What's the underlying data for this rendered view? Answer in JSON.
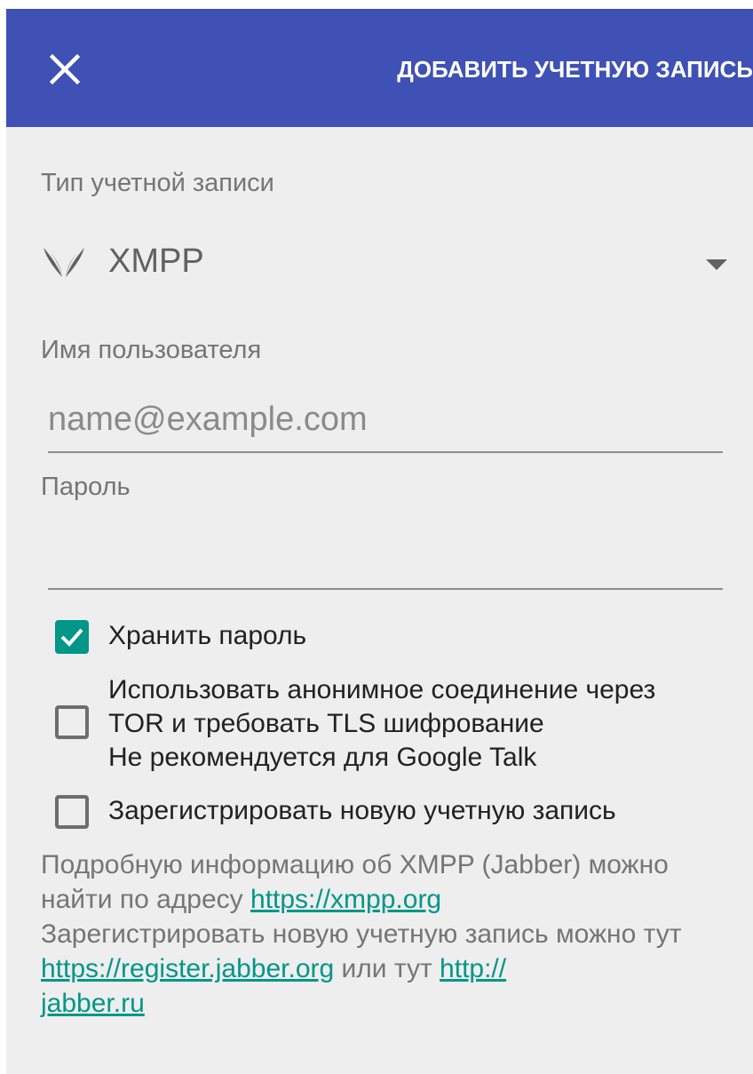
{
  "toolbar": {
    "close_icon": "close-icon",
    "action_label": "ДОБАВИТЬ УЧЕТНУЮ ЗАПИСЬ"
  },
  "account_type": {
    "label": "Тип учетной записи",
    "icon": "xmpp-logo-icon",
    "selected": "XMPP"
  },
  "username": {
    "label": "Имя пользователя",
    "value": "",
    "placeholder": "name@example.com"
  },
  "password": {
    "label": "Пароль",
    "value": ""
  },
  "options": {
    "save_password": {
      "label": "Хранить пароль",
      "checked": true
    },
    "tor": {
      "line1": "Использовать анонимное соединение через",
      "line2": "TOR и требовать TLS шифрование",
      "line3": "Не рекомендуется для Google Talk",
      "checked": false
    },
    "register": {
      "label": "Зарегистрировать новую учетную запись",
      "checked": false
    }
  },
  "info": {
    "text1": "Подробную информацию об XMPP (Jabber) можно найти по адресу ",
    "link1": "https://xmpp.org",
    "text2": "Зарегистрировать новую учетную запись можно тут ",
    "link2": "https://register.jabber.org",
    "text3": " или тут ",
    "link3_line1": "http://",
    "link3_line2": "jabber.ru"
  },
  "colors": {
    "toolbar": "#3f51b5",
    "accent": "#009688",
    "background": "#eeeeee"
  }
}
